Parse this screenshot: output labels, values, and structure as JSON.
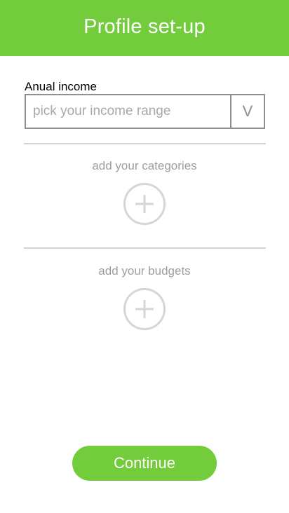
{
  "header": {
    "title": "Profile set-up"
  },
  "income": {
    "label": "Anual income",
    "placeholder": "pick your income range",
    "toggle_glyph": "V"
  },
  "categories": {
    "label": "add your categories",
    "icon": "plus-circle-icon"
  },
  "budgets": {
    "label": "add your budgets",
    "icon": "plus-circle-icon"
  },
  "footer": {
    "continue_label": "Continue"
  },
  "colors": {
    "accent": "#72cc3b",
    "border": "#8f8f8f",
    "muted_text": "#9e9e9e",
    "divider": "#d3d3d3"
  }
}
